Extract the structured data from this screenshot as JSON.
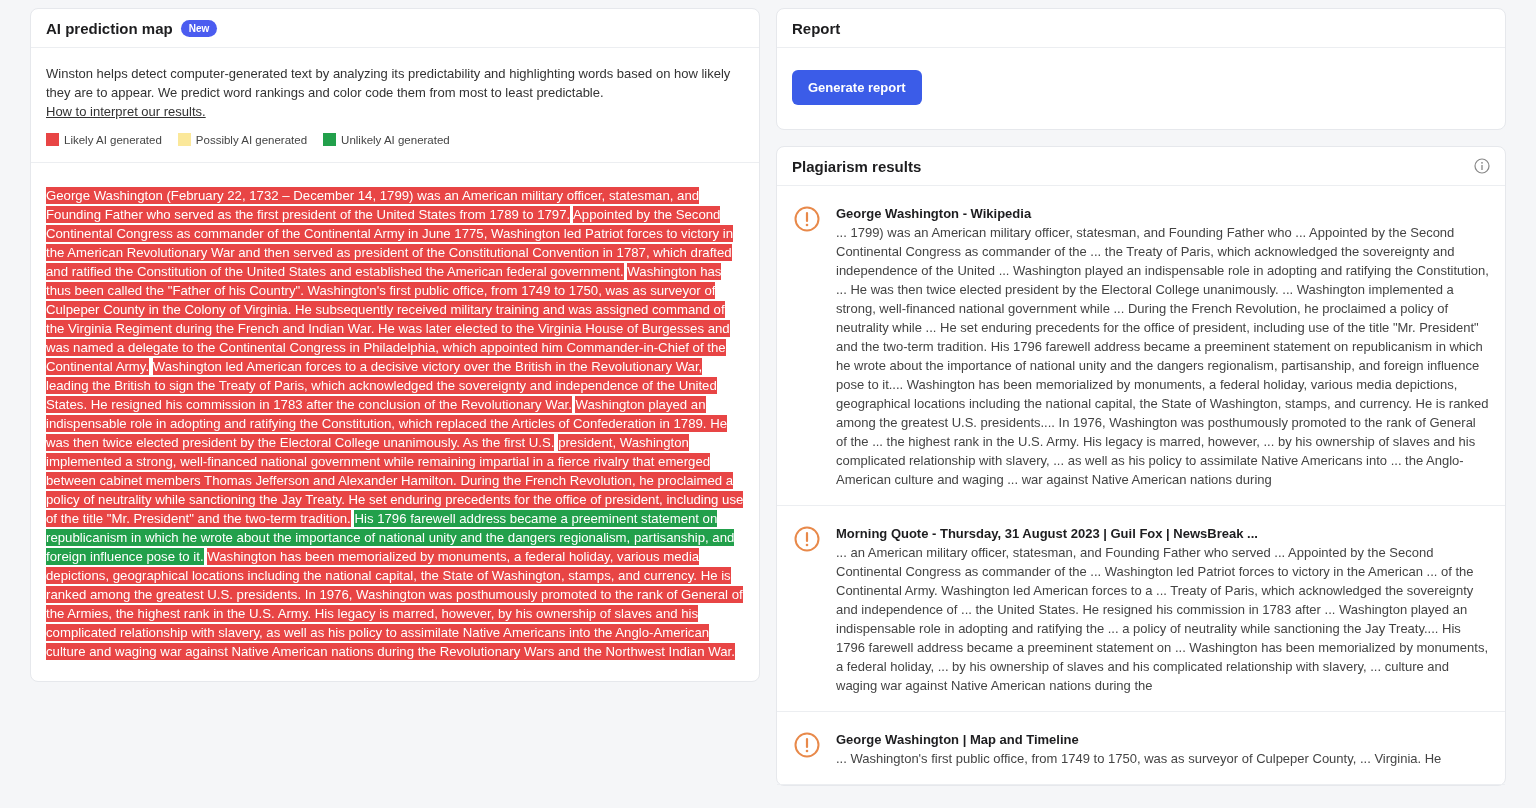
{
  "prediction_map": {
    "title": "AI prediction map",
    "badge": "New",
    "description": "Winston helps detect computer-generated text by analyzing its predictability and highlighting words based on how likely they are to appear. We predict word rankings and color code them from most to least predictable.",
    "link": "How to interpret our results.",
    "legend": [
      {
        "label": "Likely AI generated",
        "color": "#e84545"
      },
      {
        "label": "Possibly AI generated",
        "color": "#fbe89a"
      },
      {
        "label": "Unlikely AI generated",
        "color": "#22a04b"
      }
    ],
    "segments": [
      {
        "text": "George Washington (February 22, 1732 – December 14, 1799) was an American military officer, statesman, and Founding Father who served as the first president of the United States from 1789 to 1797.",
        "color": "#e84545"
      },
      {
        "text": "Appointed by the Second Continental Congress as commander of the Continental Army in June 1775, Washington led Patriot forces to victory in the American Revolutionary War and then served as president of the Constitutional Convention in 1787, which drafted and ratified the Constitution of the United States and established the American federal government.",
        "color": "#e84545"
      },
      {
        "text": "Washington has thus been called the \"Father of his Country\". Washington's first public office, from 1749 to 1750, was as surveyor of Culpeper County in the Colony of Virginia. He subsequently received military training and was assigned command of the Virginia Regiment during the French and Indian War. He was later elected to the Virginia House of Burgesses and was named a delegate to the Continental Congress in Philadelphia, which appointed him Commander-in-Chief of the Continental Army.",
        "color": "#e84545"
      },
      {
        "text": "Washington led American forces to a decisive victory over the British in the Revolutionary War, leading the British to sign the Treaty of Paris, which acknowledged the sovereignty and independence of the United States. He resigned his commission in 1783 after the conclusion of the Revolutionary War.",
        "color": "#e84545"
      },
      {
        "text": "Washington played an indispensable role in adopting and ratifying the Constitution, which replaced the Articles of Confederation in 1789. He was then twice elected president by the Electoral College unanimously. As the first U.S.",
        "color": "#e84545"
      },
      {
        "text": "president, Washington implemented a strong, well-financed national government while remaining impartial in a fierce rivalry that emerged between cabinet members Thomas Jefferson and Alexander Hamilton. During the French Revolution, he proclaimed a policy of neutrality while sanctioning the Jay Treaty. He set enduring precedents for the office of president, including use of the title \"Mr. President\" and the two-term tradition.",
        "color": "#e84545"
      },
      {
        "text": "His 1796 farewell address became a preeminent statement on republicanism in which he wrote about the importance of national unity and the dangers regionalism, partisanship, and foreign influence pose to it.",
        "color": "#22a04b"
      },
      {
        "text": "Washington has been memorialized by monuments, a federal holiday, various media depictions, geographical locations including the national capital, the State of Washington, stamps, and currency. He is ranked among the greatest U.S. presidents. In 1976, Washington was posthumously promoted to the rank of General of the Armies, the highest rank in the U.S. Army. His legacy is marred, however, by his ownership of slaves and his complicated relationship with slavery, as well as his policy to assimilate Native Americans into the Anglo-American culture and waging war against Native American nations during the Revolutionary Wars and the Northwest Indian War.",
        "color": "#e84545"
      }
    ]
  },
  "report": {
    "title": "Report",
    "button": "Generate report"
  },
  "plagiarism": {
    "title": "Plagiarism results",
    "results": [
      {
        "title": "George Washington - Wikipedia",
        "snippet": "... 1799) was an American military officer, statesman, and Founding Father who ... Appointed by the Second Continental Congress as commander of the ... the Treaty of Paris, which acknowledged the sovereignty and independence of the United ... Washington played an indispensable role in adopting and ratifying the Constitution, ... He was then twice elected president by the Electoral College unanimously. ... Washington implemented a strong, well-financed national government while ... During the French Revolution, he proclaimed a policy of neutrality while ... He set enduring precedents for the office of president, including use of the title \"Mr. President\" and the two-term tradition. His 1796 farewell address became a preeminent statement on republicanism in which he wrote about the importance of national unity and the dangers regionalism, partisanship, and foreign influence pose to it.... Washington has been memorialized by monuments, a federal holiday, various media depictions, geographical locations including the national capital, the State of Washington, stamps, and currency. He is ranked among the greatest U.S. presidents.... In 1976, Washington was posthumously promoted to the rank of General of the ... the highest rank in the U.S. Army. His legacy is marred, however, ... by his ownership of slaves and his complicated relationship with slavery, ... as well as his policy to assimilate Native Americans into ... the Anglo-American culture and waging ... war against Native American nations during"
      },
      {
        "title": "Morning Quote - Thursday, 31 August 2023 | Guil Fox | NewsBreak ...",
        "snippet": "... an American military officer, statesman, and Founding Father who served ... Appointed by the Second Continental Congress as commander of the ... Washington led Patriot forces to victory in the American ... of the Continental Army. Washington led American forces to a ... Treaty of Paris, which acknowledged the sovereignty and independence of ... the United States. He resigned his commission in 1783 after ... Washington played an indispensable role in adopting and ratifying the ... a policy of neutrality while sanctioning the Jay Treaty.... His 1796 farewell address became a preeminent statement on ... Washington has been memorialized by monuments, a federal holiday, ... by his ownership of slaves and his complicated relationship with slavery, ... culture and waging war against Native American nations during the"
      },
      {
        "title": "George Washington | Map and Timeline",
        "snippet": "... Washington's first public office, from 1749 to 1750, was as surveyor of Culpeper County, ... Virginia. He"
      }
    ]
  }
}
